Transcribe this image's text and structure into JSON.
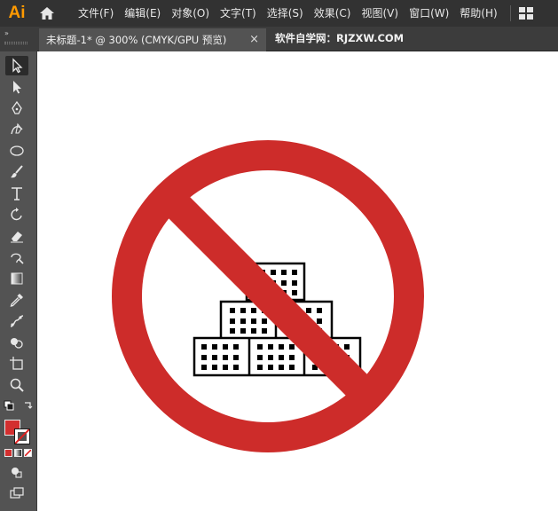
{
  "app": {
    "logo": "Ai"
  },
  "menu": {
    "items": [
      "文件(F)",
      "编辑(E)",
      "对象(O)",
      "文字(T)",
      "选择(S)",
      "效果(C)",
      "视图(V)",
      "窗口(W)",
      "帮助(H)"
    ]
  },
  "tab": {
    "title": "未标题-1* @ 300% (CMYK/GPU 预览)",
    "close": "×"
  },
  "watermark": "软件自学网：RJZXW.COM",
  "toolbar": {
    "collapse": "»"
  },
  "colors": {
    "fill": "#d32f2f",
    "prohibition_red": "#cd2c2a",
    "ui_dark": "#323232",
    "ui_panel": "#535353",
    "app_orange": "#ff9a00"
  }
}
